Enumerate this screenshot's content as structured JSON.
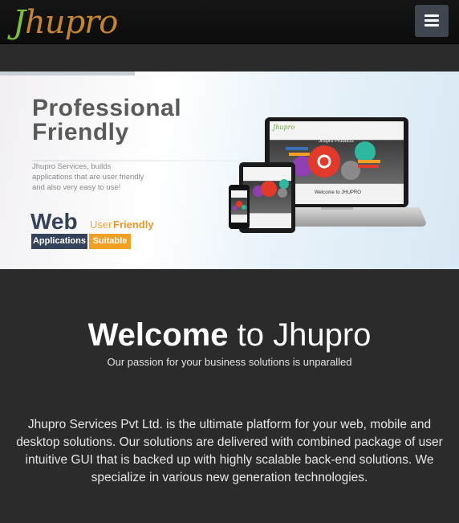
{
  "header": {
    "logo_first": "J",
    "logo_rest": "hupro",
    "menu_icon": "hamburger-icon"
  },
  "banner": {
    "headline_line1": "Professional",
    "headline_line2": "Friendly",
    "tagline": "Jhupro Services, builds applications that are user friendly and also very easy to use!",
    "web_word": "Web",
    "user_word": "User",
    "friendly_word": "Friendly",
    "badge_applications": "Applications",
    "badge_suitable": "Suitable",
    "devices": {
      "logo_text": "Jhupro",
      "screen_title": "Jhupro Products",
      "screen_welcome": "Welcome to JHUPRO"
    },
    "colors": {
      "navy": "#34435a",
      "orange": "#f2a024",
      "brand_green": "#7cc03c",
      "brand_orange": "#c5842f"
    }
  },
  "welcome": {
    "title_bold": "Welcome",
    "title_rest": "to Jhupro",
    "subtitle": "Our passion for your business solutions is unparalled"
  },
  "intro": {
    "text": "Jhupro Services Pvt Ltd. is the ultimate platform for your web, mobile and desktop solutions. Our solutions are delivered with combined package of user intuitive GUI that is backed up with highly scalable back-end solutions. We specialize in various new generation technologies."
  }
}
